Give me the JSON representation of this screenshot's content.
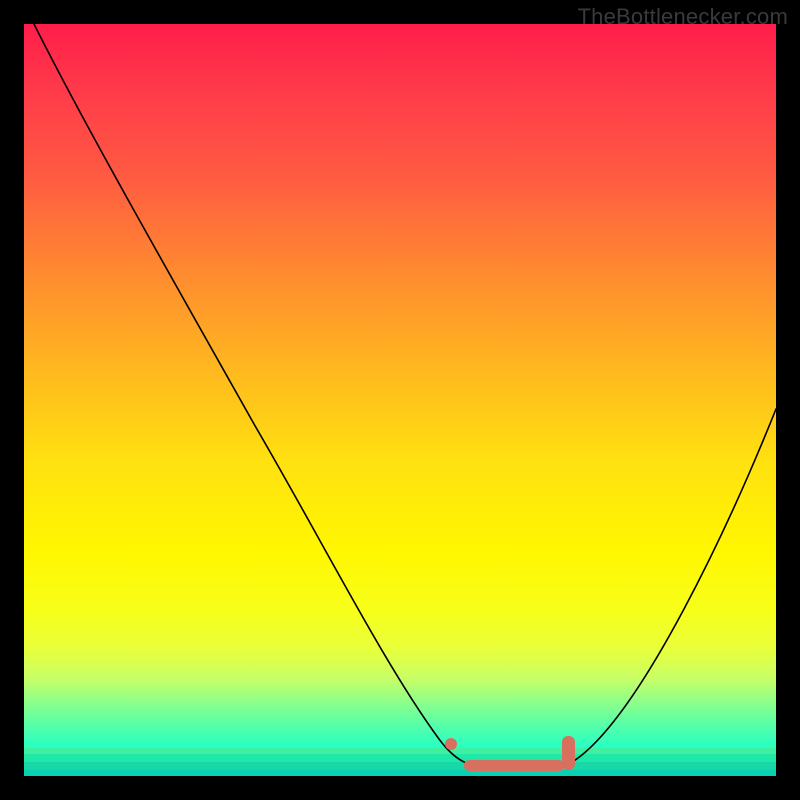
{
  "source_label": "TheBottlenecker.com",
  "chart_data": {
    "type": "line",
    "title": "",
    "xlabel": "",
    "ylabel": "",
    "xlim": [
      0,
      100
    ],
    "ylim": [
      0,
      100
    ],
    "series": [
      {
        "name": "bottleneck-curve",
        "x": [
          0,
          4,
          10,
          20,
          30,
          40,
          48,
          54,
          58,
          62,
          66,
          70,
          76,
          82,
          88,
          94,
          100
        ],
        "y": [
          100,
          96,
          89,
          75,
          60,
          45,
          30,
          18,
          9,
          4,
          2,
          2,
          5,
          13,
          25,
          38,
          52
        ]
      }
    ],
    "markers": {
      "name": "optimal-range",
      "x_start": 58,
      "x_end": 72,
      "y": 3
    },
    "color_gradient_meaning": "red=high bottleneck, green=zero bottleneck",
    "gradient_stops": [
      {
        "pos": 0,
        "color": "#ff1e4a"
      },
      {
        "pos": 50,
        "color": "#ffe010"
      },
      {
        "pos": 100,
        "color": "#0affe0"
      }
    ]
  }
}
